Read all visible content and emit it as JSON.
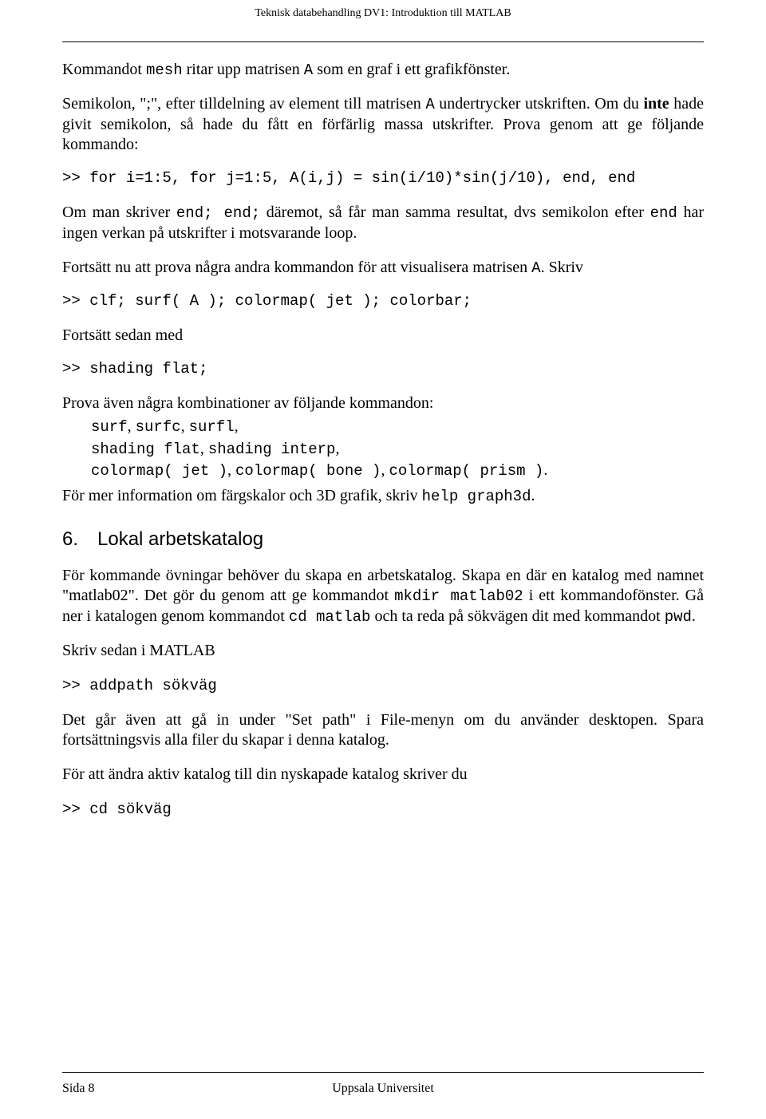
{
  "header": "Teknisk databehandling DV1: Introduktion till MATLAB",
  "p1_pre": "Kommandot ",
  "p1_code1": "mesh",
  "p1_mid1": " ritar upp matrisen ",
  "p1_code2": "A",
  "p1_post1": " som en graf i ett grafikfönster.",
  "p2_pre": "Semikolon, \";\", efter tilldelning av element till matrisen ",
  "p2_code1": "A",
  "p2_mid1": " undertrycker utskriften. Om du ",
  "p2_bold": "inte",
  "p2_post1": " hade givit semikolon, så hade du fått en förfärlig massa utskrifter. Prova genom att ge följande kommando:",
  "code1": ">> for i=1:5, for j=1:5, A(i,j) = sin(i/10)*sin(j/10), end, end",
  "p3_pre": "Om man skriver ",
  "p3_code1": "end; end;",
  "p3_mid1": " däremot, så får man samma resultat, dvs semikolon efter ",
  "p3_code2": "end",
  "p3_post1": " har ingen verkan på utskrifter i motsvarande loop.",
  "p4_pre": "Fortsätt nu att prova några andra kommandon för att visualisera matrisen ",
  "p4_code1": "A",
  "p4_post1": ". Skriv",
  "code2": ">> clf; surf( A ); colormap( jet ); colorbar;",
  "p5": "Fortsätt sedan med",
  "code3": ">> shading flat;",
  "p6": "Prova även några kombinationer av följande kommandon:",
  "list1_c1": "surf",
  "list1_c2": "surfc",
  "list1_c3": "surfl",
  "list2_c1": "shading flat",
  "list2_c2": "shading interp",
  "list3_c1": "colormap( jet )",
  "list3_c2": "colormap( bone )",
  "list3_c3": "colormap( prism )",
  "p7_pre": "För mer information om färgskalor och 3D grafik, skriv ",
  "p7_code1": "help graph3d",
  "p7_post1": ".",
  "section_num": "6.",
  "section_title": "Lokal arbetskatalog",
  "p8_pre": "För kommande övningar behöver du skapa en arbetskatalog. Skapa en där en katalog med namnet \"matlab02\". Det gör du genom att ge kommandot ",
  "p8_code1": "mkdir matlab02",
  "p8_mid1": " i ett kommandofönster. Gå ner i katalogen genom kommandot ",
  "p8_code2": "cd matlab",
  "p8_mid2": " och ta reda på sökvägen dit med kommandot ",
  "p8_code3": "pwd",
  "p8_post1": ".",
  "p9": "Skriv sedan i MATLAB",
  "code4": ">> addpath sökväg",
  "p10": "Det går även att gå in under \"Set path\" i File-menyn om du använder desktopen. Spara fortsättningsvis alla filer du skapar i denna katalog.",
  "p11": "För att ändra aktiv katalog till din nyskapade katalog skriver du",
  "code5": ">> cd sökväg",
  "footer_left": "Sida 8",
  "footer_center": "Uppsala Universitet",
  "footer_right": ""
}
